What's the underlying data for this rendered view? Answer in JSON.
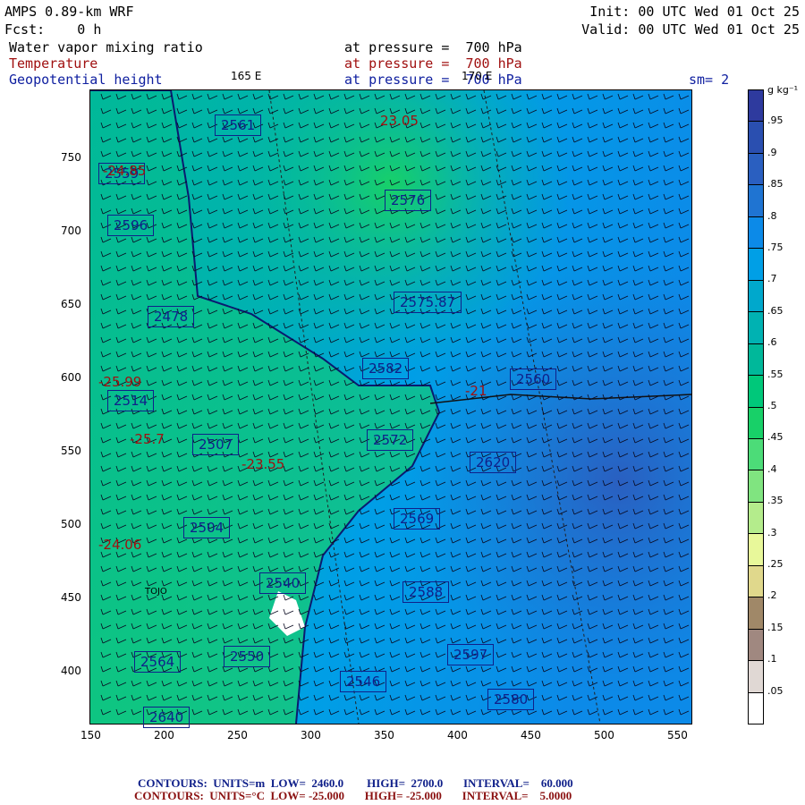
{
  "header": {
    "model": "AMPS 0.89-km WRF",
    "fcst": "Fcst:    0 h",
    "init": "Init: 00 UTC Wed 01 Oct 25",
    "valid": "Valid: 00 UTC Wed 01 Oct 25",
    "field1": "Water vapor mixing ratio",
    "field2": "Temperature",
    "field3": "Geopotential height",
    "level1": "at pressure =  700 hPa",
    "level2": "at pressure =  700 hPa",
    "level3": "at pressure =  700 hPa",
    "smooth": "sm= 2",
    "lon1": "165 E",
    "lon2": "170 E"
  },
  "colorbar": {
    "units": "g kg⁻¹",
    "labels": [
      ".95",
      ".9",
      ".85",
      ".8",
      ".75",
      ".7",
      ".65",
      ".6",
      ".55",
      ".5",
      ".45",
      ".4",
      ".35",
      ".3",
      ".25",
      ".2",
      ".15",
      ".1",
      ".05"
    ],
    "colors": [
      "#2e3a9e",
      "#2a4fb0",
      "#2a5fc0",
      "#1f74d2",
      "#0c8ae8",
      "#009fe6",
      "#00a8cc",
      "#00b2b2",
      "#00b89a",
      "#00c87a",
      "#18d068",
      "#4cdc78",
      "#80e480",
      "#b4ec8c",
      "#e8f89a",
      "#e0d88c",
      "#a08868",
      "#a08880",
      "#e0d8d4",
      "#ffffff"
    ]
  },
  "axes": {
    "x_ticks": [
      "150",
      "200",
      "250",
      "300",
      "350",
      "400",
      "450",
      "500",
      "550"
    ],
    "y_ticks": [
      "750",
      "700",
      "650",
      "600",
      "550",
      "500",
      "450",
      "400"
    ]
  },
  "map_labels": {
    "heights": [
      "2561",
      "2559",
      "2596",
      "2478",
      "2576",
      "2575.87",
      "2582",
      "2560",
      "2514",
      "2507",
      "2572",
      "2620",
      "2504",
      "2569",
      "2540",
      "2588",
      "2564",
      "2550",
      "2546",
      "2597",
      "2640",
      "2580"
    ],
    "temps": [
      "23.05",
      "-24.85",
      "-21",
      "-25.99",
      "-25.7",
      "-24.06",
      "-23.55"
    ],
    "place": "TOJO"
  },
  "footer": {
    "c1": "CONTOURS:  UNITS=m  LOW=  2460.0        HIGH=  2700.0       INTERVAL=    60.000",
    "c2": "CONTOURS:  UNITS=°C  LOW= -25.000       HIGH= -25.000       INTERVAL=    5.0000"
  }
}
